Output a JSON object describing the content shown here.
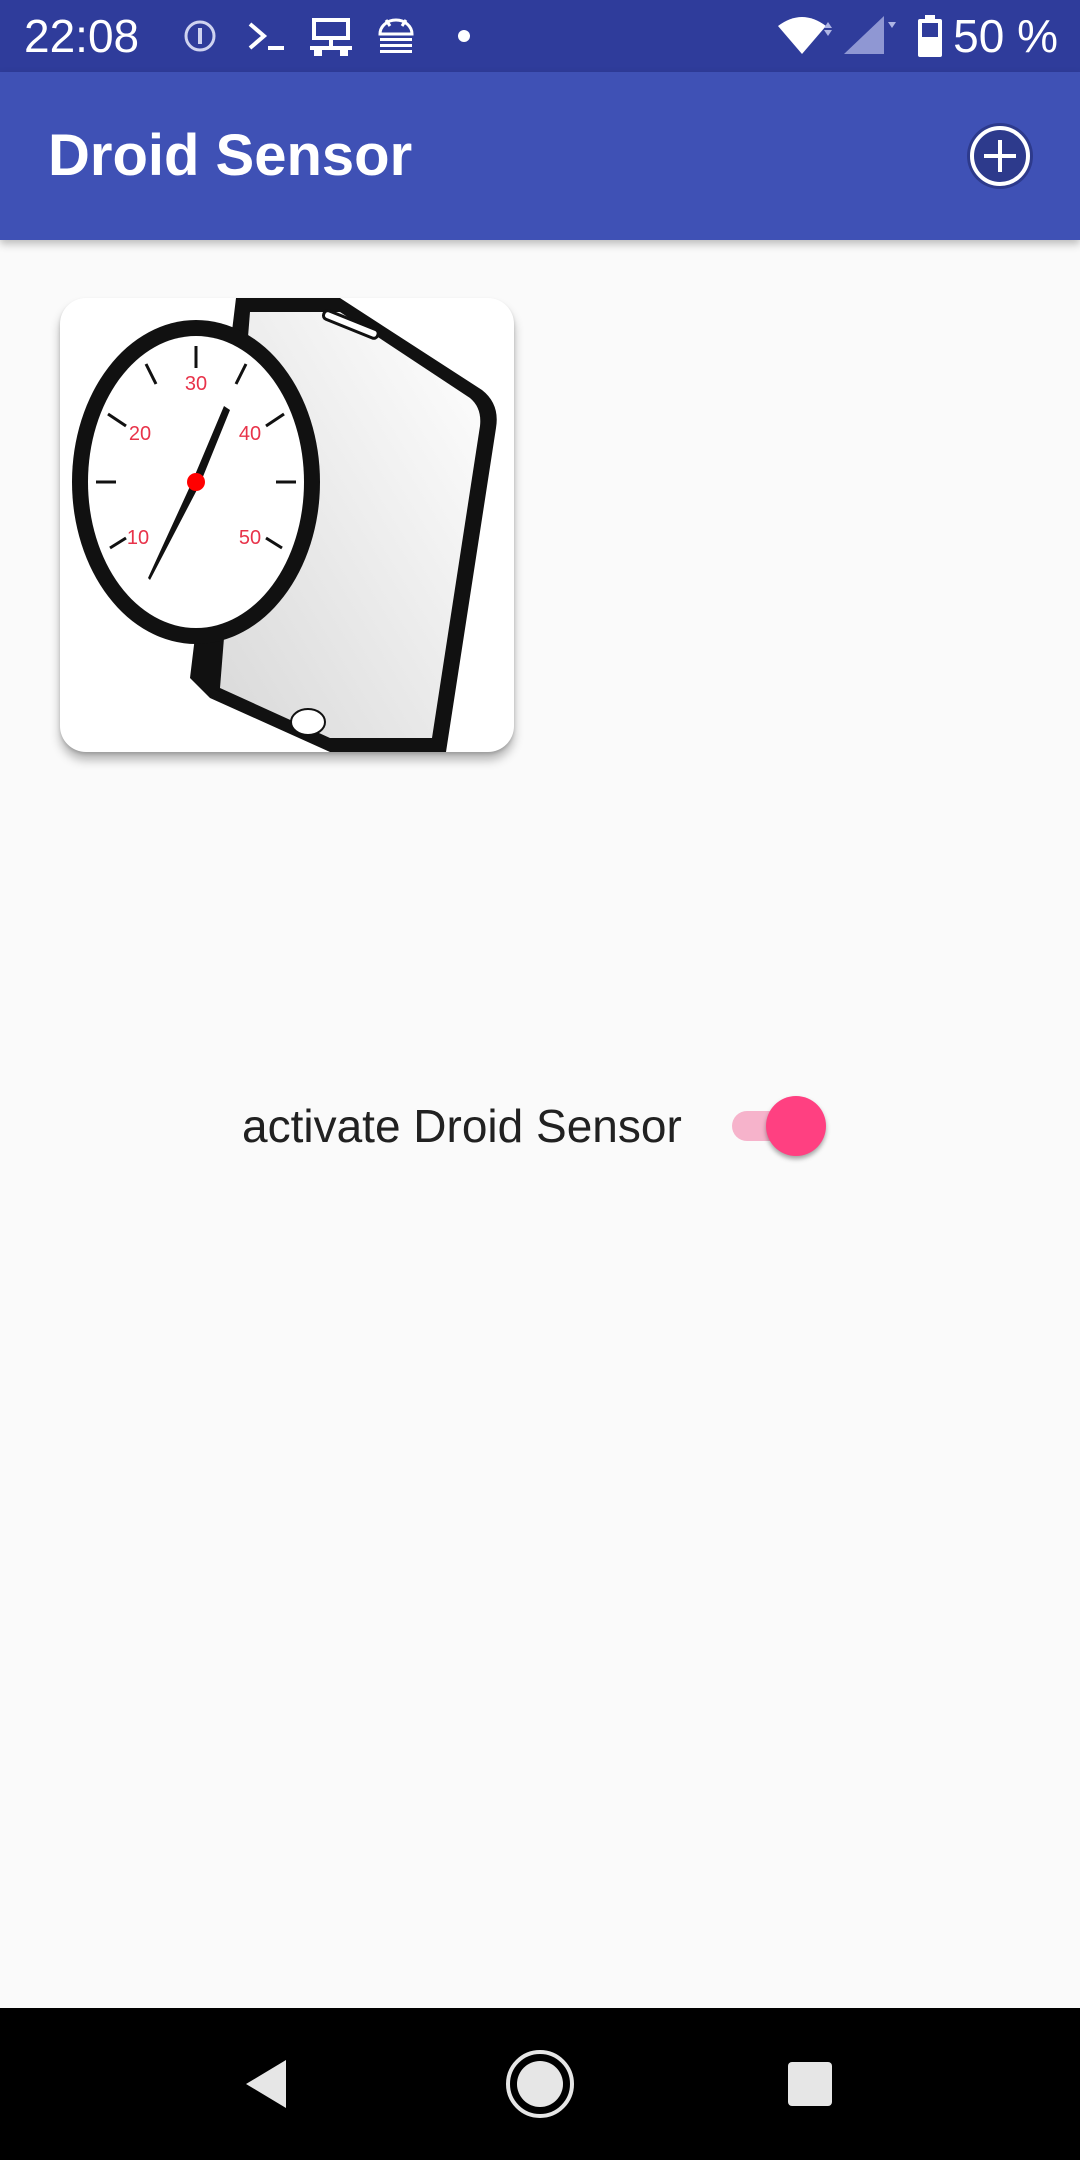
{
  "status_bar": {
    "time": "22:08",
    "battery_text": "50 %",
    "icons": [
      "info-icon",
      "terminal-icon",
      "network-icon",
      "android-debug-icon",
      "dot-icon",
      "wifi-icon",
      "signal-icon",
      "battery-icon"
    ]
  },
  "app_bar": {
    "title": "Droid Sensor",
    "action_icon": "add-circle-icon"
  },
  "logo": {
    "gauge_labels": [
      "10",
      "20",
      "30",
      "40",
      "50"
    ],
    "colors": {
      "needle_hub": "#ff0000",
      "labels": "#e8334a"
    }
  },
  "toggle": {
    "label": "activate Droid Sensor",
    "checked": true,
    "accent": "#ff4081"
  },
  "nav_bar": {
    "icons": [
      "back-icon",
      "home-icon",
      "recents-icon"
    ]
  },
  "colors": {
    "status_bar": "#2f3c9b",
    "app_bar": "#3f51b5",
    "background": "#fafafa",
    "nav_bar": "#000000"
  }
}
